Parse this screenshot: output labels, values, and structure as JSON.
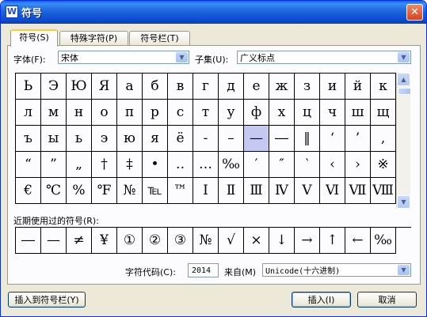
{
  "window": {
    "title": "符号",
    "app_icon": "W",
    "close_glyph": "✕"
  },
  "tabs": [
    {
      "label": "符号(S)"
    },
    {
      "label": "特殊字符(P)"
    },
    {
      "label": "符号栏(T)"
    }
  ],
  "font": {
    "label": "字体(F):",
    "value": "宋体"
  },
  "subset": {
    "label": "子集(U):",
    "value": "广义标点"
  },
  "symbol_grid": [
    [
      "Ь",
      "Э",
      "Ю",
      "Я",
      "а",
      "б",
      "в",
      "г",
      "д",
      "е",
      "ж",
      "з",
      "и",
      "й",
      "к"
    ],
    [
      "л",
      "м",
      "н",
      "о",
      "п",
      "р",
      "с",
      "т",
      "у",
      "ф",
      "х",
      "ц",
      "ч",
      "ш",
      "щ"
    ],
    [
      "ъ",
      "ы",
      "ь",
      "э",
      "ю",
      "я",
      "ё",
      "‐",
      "–",
      "—",
      "―",
      "‖",
      "‘",
      "’",
      "‚"
    ],
    [
      "“",
      "”",
      "„",
      "†",
      "‡",
      "•",
      "‥",
      "…",
      "‰",
      "′",
      "″",
      "‵",
      "‹",
      "›",
      "※"
    ],
    [
      "€",
      "℃",
      "%",
      "℉",
      "№",
      "℡",
      "™",
      "Ⅰ",
      "Ⅱ",
      "Ⅲ",
      "Ⅳ",
      "Ⅴ",
      "Ⅵ",
      "Ⅶ",
      "Ⅷ"
    ]
  ],
  "selected_symbol": {
    "row": 2,
    "col": 9
  },
  "recent": {
    "label": "近期使用过的符号(R):",
    "symbols": [
      "―",
      "—",
      "≠",
      "¥",
      "①",
      "②",
      "③",
      "№",
      "√",
      "×",
      "↓",
      "→",
      "↑",
      "←",
      "‰"
    ]
  },
  "char_code": {
    "label": "字符代码(C):",
    "value": "2014"
  },
  "source": {
    "label": "来自(M)",
    "value": "Unicode(十六进制)"
  },
  "buttons": {
    "insert_to_bar": "插入到符号栏(Y)",
    "insert": "插入(I)",
    "cancel": "取消"
  },
  "icons": {
    "dropdown": "chevron-down-icon",
    "scroll_up": "arrow-up-icon",
    "scroll_down": "arrow-down-icon",
    "close": "close-icon"
  }
}
